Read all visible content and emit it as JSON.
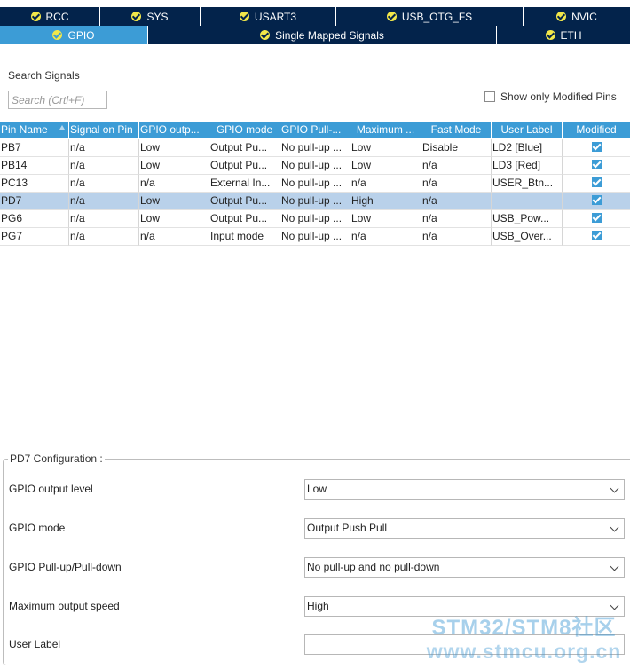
{
  "tabs_row1": [
    {
      "label": "RCC",
      "active": false
    },
    {
      "label": "SYS",
      "active": false
    },
    {
      "label": "USART3",
      "active": false
    },
    {
      "label": "USB_OTG_FS",
      "active": false
    },
    {
      "label": "NVIC",
      "active": false
    }
  ],
  "tabs_row2": [
    {
      "label": "GPIO",
      "active": true
    },
    {
      "label": "Single Mapped Signals",
      "active": false
    },
    {
      "label": "ETH",
      "active": false
    }
  ],
  "tab_icon": "check-circle-icon",
  "search": {
    "label": "Search Signals",
    "placeholder": "Search (Crtl+F)",
    "value": ""
  },
  "filter": {
    "label": "Show only Modified Pins",
    "checked": false
  },
  "table": {
    "columns": [
      "Pin Name",
      "Signal on Pin",
      "GPIO outp...",
      "GPIO mode",
      "GPIO Pull-...",
      "Maximum ...",
      "Fast Mode",
      "User Label",
      "Modified"
    ],
    "sorted_column": "Pin Name",
    "rows": [
      {
        "cells": [
          "PB7",
          "n/a",
          "Low",
          "Output Pu...",
          "No pull-up ...",
          "Low",
          "Disable",
          "LD2 [Blue]"
        ],
        "modified": true,
        "selected": false
      },
      {
        "cells": [
          "PB14",
          "n/a",
          "Low",
          "Output Pu...",
          "No pull-up ...",
          "Low",
          "n/a",
          "LD3 [Red]"
        ],
        "modified": true,
        "selected": false
      },
      {
        "cells": [
          "PC13",
          "n/a",
          "n/a",
          "External In...",
          "No pull-up ...",
          "n/a",
          "n/a",
          "USER_Btn..."
        ],
        "modified": true,
        "selected": false
      },
      {
        "cells": [
          "PD7",
          "n/a",
          "Low",
          "Output Pu...",
          "No pull-up ...",
          "High",
          "n/a",
          ""
        ],
        "modified": true,
        "selected": true
      },
      {
        "cells": [
          "PG6",
          "n/a",
          "Low",
          "Output Pu...",
          "No pull-up ...",
          "Low",
          "n/a",
          "USB_Pow..."
        ],
        "modified": true,
        "selected": false
      },
      {
        "cells": [
          "PG7",
          "n/a",
          "n/a",
          "Input mode",
          "No pull-up ...",
          "n/a",
          "n/a",
          "USB_Over..."
        ],
        "modified": true,
        "selected": false
      }
    ]
  },
  "config": {
    "title": "PD7 Configuration :",
    "fields": [
      {
        "label": "GPIO output level",
        "value": "Low",
        "type": "select"
      },
      {
        "label": "GPIO mode",
        "value": "Output Push Pull",
        "type": "select"
      },
      {
        "label": "GPIO Pull-up/Pull-down",
        "value": "No pull-up and no pull-down",
        "type": "select"
      },
      {
        "label": "Maximum output speed",
        "value": "High",
        "type": "select"
      },
      {
        "label": "User Label",
        "value": "",
        "type": "input"
      }
    ]
  },
  "watermark": {
    "line1": "STM32/STM8社区",
    "line2": "www.stmcu.org.cn"
  },
  "colors": {
    "tab_bg": "#03234b",
    "tab_active": "#3c9cd6",
    "header_bg": "#3c9cd6",
    "selected_row": "#b9d1ea",
    "tab_check": "#f2e74a"
  }
}
